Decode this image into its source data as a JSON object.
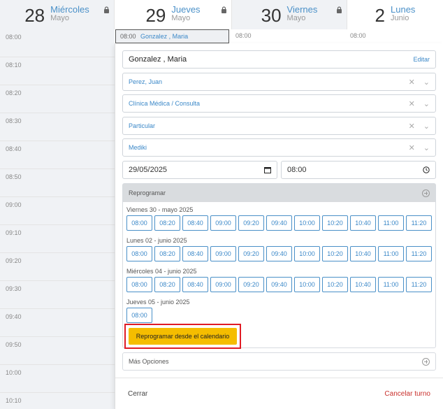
{
  "calendar": {
    "days": [
      {
        "num": "28",
        "name": "Miércoles",
        "month": "Mayo"
      },
      {
        "num": "29",
        "name": "Jueves",
        "month": "Mayo"
      },
      {
        "num": "30",
        "name": "Viernes",
        "month": "Mayo"
      },
      {
        "num": "2",
        "name": "Lunes",
        "month": "Junio"
      }
    ],
    "times": [
      "08:00",
      "08:10",
      "08:20",
      "08:30",
      "08:40",
      "08:50",
      "09:00",
      "09:10",
      "09:20",
      "09:30",
      "09:40",
      "09:50",
      "10:00",
      "10:10"
    ],
    "appointment": {
      "time": "08:00",
      "name": "Gonzalez , Maria"
    },
    "col_times": {
      "viernes": "08:00",
      "lunes": "08:00"
    }
  },
  "panel": {
    "patient": "Gonzalez , Maria",
    "edit_label": "Editar",
    "professional": "Perez, Juan",
    "service": "Clínica Médica / Consulta",
    "coverage": "Particular",
    "plan": "Mediki",
    "date": "29/05/2025",
    "time": "08:00",
    "reschedule": {
      "title": "Reprogramar",
      "days": [
        {
          "label": "Viernes 30 - mayo 2025",
          "slots": [
            "08:00",
            "08:20",
            "08:40",
            "09:00",
            "09:20",
            "09:40",
            "10:00",
            "10:20",
            "10:40",
            "11:00",
            "11:20"
          ]
        },
        {
          "label": "Lunes 02 - junio 2025",
          "slots": [
            "08:00",
            "08:20",
            "08:40",
            "09:00",
            "09:20",
            "09:40",
            "10:00",
            "10:20",
            "10:40",
            "11:00",
            "11:20"
          ]
        },
        {
          "label": "Miércoles 04 - junio 2025",
          "slots": [
            "08:00",
            "08:20",
            "08:40",
            "09:00",
            "09:20",
            "09:40",
            "10:00",
            "10:20",
            "10:40",
            "11:00",
            "11:20"
          ]
        },
        {
          "label": "Jueves 05 - junio 2025",
          "slots": [
            "08:00"
          ]
        }
      ],
      "calendar_button": "Reprogramar desde el calendario"
    },
    "more_options": "Más Opciones",
    "close_label": "Cerrar",
    "cancel_label": "Cancelar turno"
  },
  "colors": {
    "accent": "#3b88c8",
    "cta": "#f5bd00",
    "danger": "#c9302c",
    "highlight": "#e01b24"
  }
}
